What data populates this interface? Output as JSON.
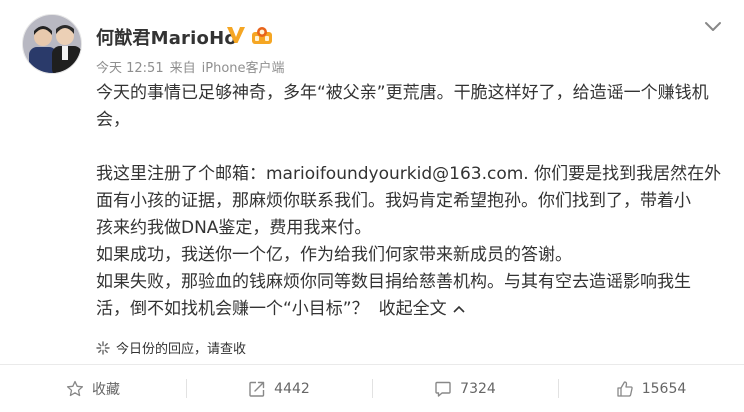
{
  "post": {
    "author": "何猷君MarioHo",
    "verified_badge": "V",
    "medal_icon": "medal-icon",
    "time": "今天 12:51",
    "source_prefix": "来自",
    "source": "iPhone客户端",
    "content_lines": [
      "今天的事情已足够神奇，多年“被父亲”更荒唐。干脆这样好了，给造谣一个赚钱机",
      "会，",
      "",
      "我这里注册了个邮箱：marioifoundyourkid@163.com. 你们要是找到我居然在外",
      "面有小孩的证据，那麻烦你联系我们。我妈肯定希望抱孙。你们找到了，带着小",
      "孩来约我做DNA鉴定，费用我来付。",
      "如果成功，我送你一个亿，作为给我们何家带来新成员的答谢。",
      "如果失败，那验血的钱麻烦你同等数目捐给慈善机构。与其有空去造谣影响我生",
      "活，倒不如找机会赚一个“小目标”？"
    ],
    "collapse_label": "收起全文",
    "replies_text": "今日份的回应，请查收"
  },
  "actions": {
    "favorite_label": "收藏",
    "repost_count": "4442",
    "comment_count": "7324",
    "like_count": "15654"
  },
  "colors": {
    "text": "#333333",
    "meta": "#8f8f8f",
    "badge": "#f5a623",
    "icon": "#888888"
  }
}
